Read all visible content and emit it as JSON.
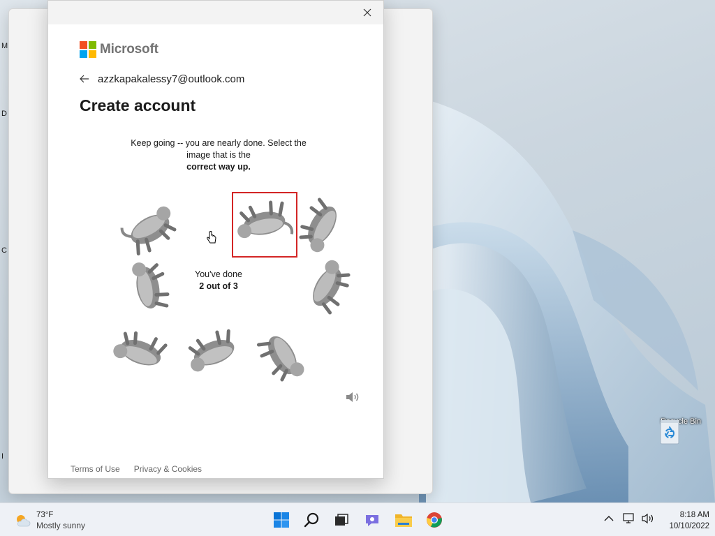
{
  "desktop": {
    "left_edge_labels": [
      "M",
      "D",
      "C",
      "I"
    ],
    "recycle_bin": {
      "label": "Recycle Bin",
      "icon": "recycle-bin-icon"
    }
  },
  "dialog": {
    "brand": "Microsoft",
    "identity_email": "azzkapakalessy7@outlook.com",
    "title": "Create account",
    "challenge": {
      "instruction_line1": "Keep going -- you are nearly done. Select the image that is the",
      "instruction_strong": "correct way up.",
      "progress_line1": "You've done",
      "progress_strong": "2 out of 3",
      "selected_tile": 1
    },
    "footer": {
      "terms": "Terms of Use",
      "privacy": "Privacy & Cookies"
    }
  },
  "taskbar": {
    "weather": {
      "temp": "73°F",
      "description": "Mostly sunny",
      "icon": "partly-sunny-icon"
    },
    "apps": [
      "start-icon",
      "search-icon",
      "task-view-icon",
      "teams-chat-icon",
      "file-explorer-icon",
      "chrome-icon"
    ],
    "tray_icons": [
      "chevron-up-icon",
      "network-icon",
      "volume-icon"
    ],
    "clock": {
      "time": "8:18 AM",
      "date": "10/10/2022"
    }
  },
  "colors": {
    "selection_border": "#d32525",
    "ms_red": "#f25022",
    "ms_green": "#7fba00",
    "ms_blue": "#00a4ef",
    "ms_yellow": "#ffb900"
  }
}
